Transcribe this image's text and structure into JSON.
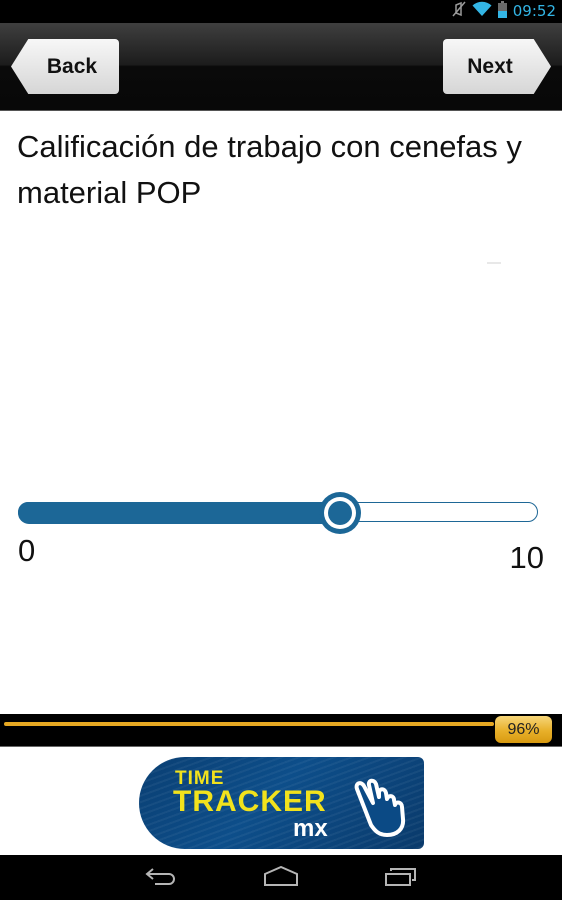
{
  "status_bar": {
    "time": "09:52",
    "icons": [
      "mute-icon",
      "wifi-icon",
      "battery-icon"
    ]
  },
  "nav": {
    "back_label": "Back",
    "next_label": "Next"
  },
  "question": {
    "text": "Calificación de trabajo con cenefas y material POP"
  },
  "slider": {
    "min_label": "0",
    "max_label": "10",
    "min": 0,
    "max": 10,
    "value": 6.2
  },
  "progress": {
    "percent": 96,
    "label": "96%"
  },
  "ad": {
    "line1": "TIME",
    "line2": "TRACKER",
    "line3": "mx",
    "icon": "pointing-hand-icon"
  },
  "system_nav": {
    "buttons": [
      "back-icon",
      "home-icon",
      "recent-apps-icon"
    ]
  },
  "colors": {
    "accent": "#1c6797",
    "progress": "#e6a823",
    "status_text": "#33b5e5"
  }
}
